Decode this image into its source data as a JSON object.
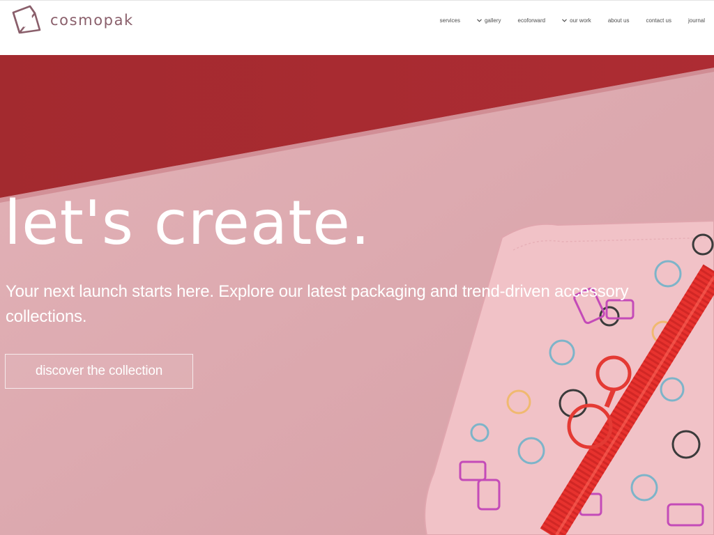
{
  "brand": {
    "name": "cosmopak",
    "logo_icon": "cosmopak-logo-mark"
  },
  "nav": {
    "items": [
      {
        "label": "services",
        "has_dropdown": false
      },
      {
        "label": "gallery",
        "has_dropdown": true
      },
      {
        "label": "ecoforward",
        "has_dropdown": false
      },
      {
        "label": "our work",
        "has_dropdown": true
      },
      {
        "label": "about us",
        "has_dropdown": false
      },
      {
        "label": "contact us",
        "has_dropdown": false
      },
      {
        "label": "journal",
        "has_dropdown": false
      }
    ]
  },
  "hero": {
    "title": "let's create.",
    "subtitle": "Your next launch starts here. Explore our latest packaging and trend-driven accessory collections.",
    "cta_label": "discover the collection",
    "image_subject": "pink printed zip pouch with red zipper",
    "colors": {
      "background": "#dca8ae",
      "accent": "#a8242b",
      "zipper": "#e8322e"
    }
  }
}
